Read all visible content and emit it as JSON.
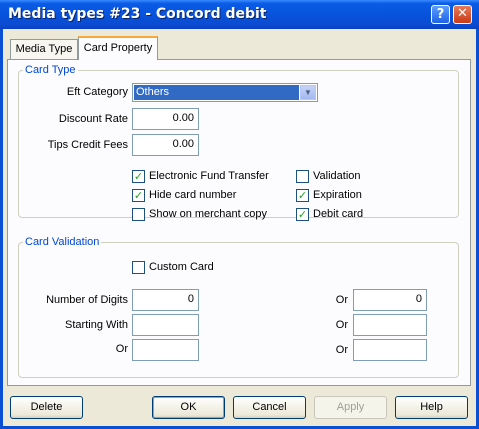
{
  "window": {
    "title": "Media types #23 - Concord debit",
    "help_glyph": "?",
    "close_glyph": "✕"
  },
  "tabs": [
    {
      "label": "Media Type",
      "active": false
    },
    {
      "label": "Card Property",
      "active": true
    }
  ],
  "card_type": {
    "legend": "Card Type",
    "eft_category_label": "Eft Category",
    "eft_category_value": "Others",
    "discount_rate_label": "Discount Rate",
    "discount_rate_value": "0.00",
    "tips_credit_fees_label": "Tips Credit Fees",
    "tips_credit_fees_value": "0.00",
    "checkboxes": [
      {
        "label": "Electronic Fund Transfer",
        "checked": true
      },
      {
        "label": "Validation",
        "checked": false
      },
      {
        "label": "Hide card number",
        "checked": true
      },
      {
        "label": "Expiration",
        "checked": true
      },
      {
        "label": "Show on merchant copy",
        "checked": false
      },
      {
        "label": "Debit card",
        "checked": true
      }
    ]
  },
  "card_validation": {
    "legend": "Card Validation",
    "custom_card_label": "Custom Card",
    "custom_card_checked": false,
    "number_of_digits_label": "Number of Digits",
    "number_of_digits_value": "0",
    "starting_with_label": "Starting With",
    "starting_with_value": "",
    "or_label": "Or",
    "left_or_value": "",
    "right_rows": [
      {
        "label": "Or",
        "value": "0"
      },
      {
        "label": "Or",
        "value": ""
      },
      {
        "label": "Or",
        "value": ""
      }
    ]
  },
  "buttons": {
    "delete": "Delete",
    "ok": "OK",
    "cancel": "Cancel",
    "apply": "Apply",
    "help": "Help"
  },
  "colors": {
    "titlebar": "#0853dc",
    "dialog_bg": "#ece9d8",
    "legend": "#0046d5",
    "active_tab_accent": "#f8a93b",
    "selection": "#316ac5",
    "check": "#21a121"
  }
}
